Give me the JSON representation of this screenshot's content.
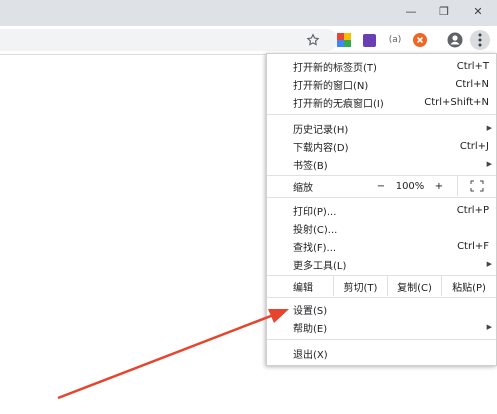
{
  "colors": {
    "arrow": "#e8432c",
    "titlebar": "#dee1e6",
    "menu_bg": "#ffffff"
  },
  "window_controls": {
    "minimize": "—",
    "restore": "❐",
    "close": "✕"
  },
  "toolbar": {
    "star_icon": "star-icon",
    "ext2_label": "(a)",
    "menu_icon": "three-dots-vertical-icon"
  },
  "menu": {
    "new_tab": {
      "label": "打开新的标签页(T)",
      "shortcut": "Ctrl+T"
    },
    "new_window": {
      "label": "打开新的窗口(N)",
      "shortcut": "Ctrl+N"
    },
    "new_incognito": {
      "label": "打开新的无痕窗口(I)",
      "shortcut": "Ctrl+Shift+N"
    },
    "history": {
      "label": "历史记录(H)"
    },
    "downloads": {
      "label": "下载内容(D)",
      "shortcut": "Ctrl+J"
    },
    "bookmarks": {
      "label": "书签(B)"
    },
    "zoom": {
      "label": "缩放",
      "minus": "−",
      "value": "100%",
      "plus": "+",
      "fullscreen_icon": "fullscreen-icon"
    },
    "print": {
      "label": "打印(P)...",
      "shortcut": "Ctrl+P"
    },
    "cast": {
      "label": "投射(C)..."
    },
    "find": {
      "label": "查找(F)...",
      "shortcut": "Ctrl+F"
    },
    "more_tools": {
      "label": "更多工具(L)"
    },
    "edit": {
      "label": "编辑",
      "cut": "剪切(T)",
      "copy": "复制(C)",
      "paste": "粘贴(P)"
    },
    "settings": {
      "label": "设置(S)"
    },
    "help": {
      "label": "帮助(E)"
    },
    "exit": {
      "label": "退出(X)"
    }
  }
}
